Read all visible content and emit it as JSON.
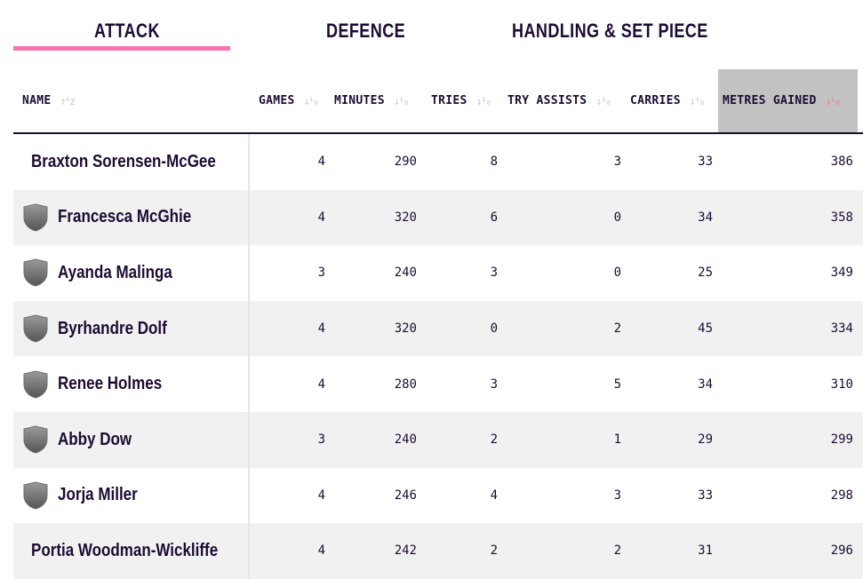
{
  "tabs": [
    {
      "label": "ATTACK",
      "active": true
    },
    {
      "label": "DEFENCE",
      "active": false
    },
    {
      "label": "HANDLING & SET PIECE",
      "active": false
    }
  ],
  "accent_color": "#f575ae",
  "table": {
    "headers": {
      "name": "NAME",
      "games": "GAMES",
      "minutes": "MINUTES",
      "tries": "TRIES",
      "try_assists": "TRY ASSISTS",
      "carries": "CARRIES",
      "metres_gained": "METRES GAINED"
    },
    "sort_icon": "sort-arrows-icon",
    "sorted_by": "metres_gained",
    "rows": [
      {
        "name": "Braxton Sorensen-McGee",
        "games": "4",
        "minutes": "290",
        "tries": "8",
        "try_assists": "3",
        "carries": "33",
        "metres_gained": "386"
      },
      {
        "name": "Francesca McGhie",
        "games": "4",
        "minutes": "320",
        "tries": "6",
        "try_assists": "0",
        "carries": "34",
        "metres_gained": "358"
      },
      {
        "name": "Ayanda Malinga",
        "games": "3",
        "minutes": "240",
        "tries": "3",
        "try_assists": "0",
        "carries": "25",
        "metres_gained": "349"
      },
      {
        "name": "Byrhandre Dolf",
        "games": "4",
        "minutes": "320",
        "tries": "0",
        "try_assists": "2",
        "carries": "45",
        "metres_gained": "334"
      },
      {
        "name": "Renee Holmes",
        "games": "4",
        "minutes": "280",
        "tries": "3",
        "try_assists": "5",
        "carries": "34",
        "metres_gained": "310"
      },
      {
        "name": "Abby Dow",
        "games": "3",
        "minutes": "240",
        "tries": "2",
        "try_assists": "1",
        "carries": "29",
        "metres_gained": "299"
      },
      {
        "name": "Jorja Miller",
        "games": "4",
        "minutes": "246",
        "tries": "4",
        "try_assists": "3",
        "carries": "33",
        "metres_gained": "298"
      },
      {
        "name": "Portia Woodman-Wickliffe",
        "games": "4",
        "minutes": "242",
        "tries": "2",
        "try_assists": "2",
        "carries": "31",
        "metres_gained": "296"
      }
    ]
  }
}
